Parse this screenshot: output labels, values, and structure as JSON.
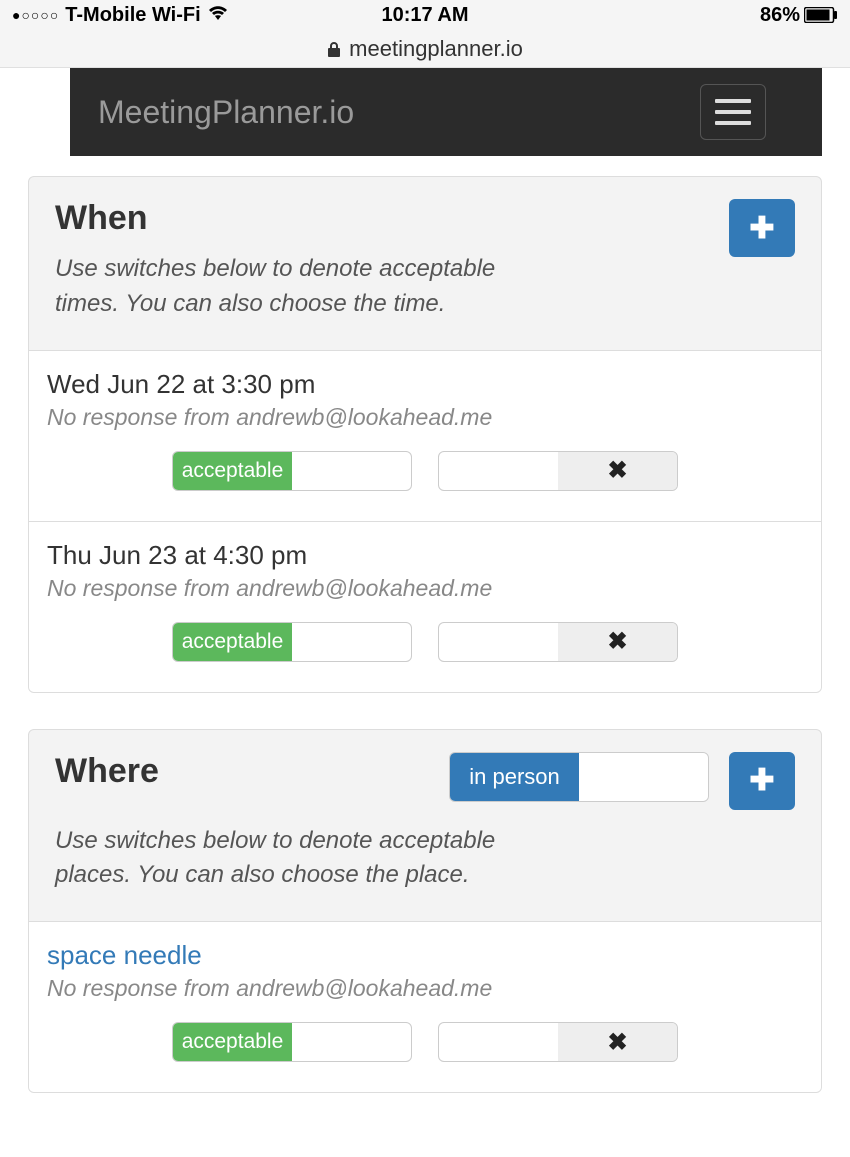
{
  "status": {
    "signal_dots": "●○○○○",
    "carrier": "T-Mobile Wi-Fi",
    "time": "10:17 AM",
    "battery_pct": "86%"
  },
  "url": "meetingplanner.io",
  "brand": "MeetingPlanner.io",
  "panels": {
    "when": {
      "title": "When",
      "instructions": "Use switches below to denote acceptable times.  You can also choose the time.",
      "items": [
        {
          "title": "Wed Jun 22 at 3:30 pm",
          "sub": "No response from andrewb@lookahead.me",
          "accept_label": "acceptable"
        },
        {
          "title": "Thu Jun 23 at 4:30 pm",
          "sub": "No response from andrewb@lookahead.me",
          "accept_label": "acceptable"
        }
      ]
    },
    "where": {
      "title": "Where",
      "mode_label": "in person",
      "instructions": "Use switches below to denote acceptable places.  You can also choose the place.",
      "items": [
        {
          "title": "space needle",
          "sub": "No response from andrewb@lookahead.me",
          "accept_label": "acceptable"
        }
      ]
    }
  }
}
